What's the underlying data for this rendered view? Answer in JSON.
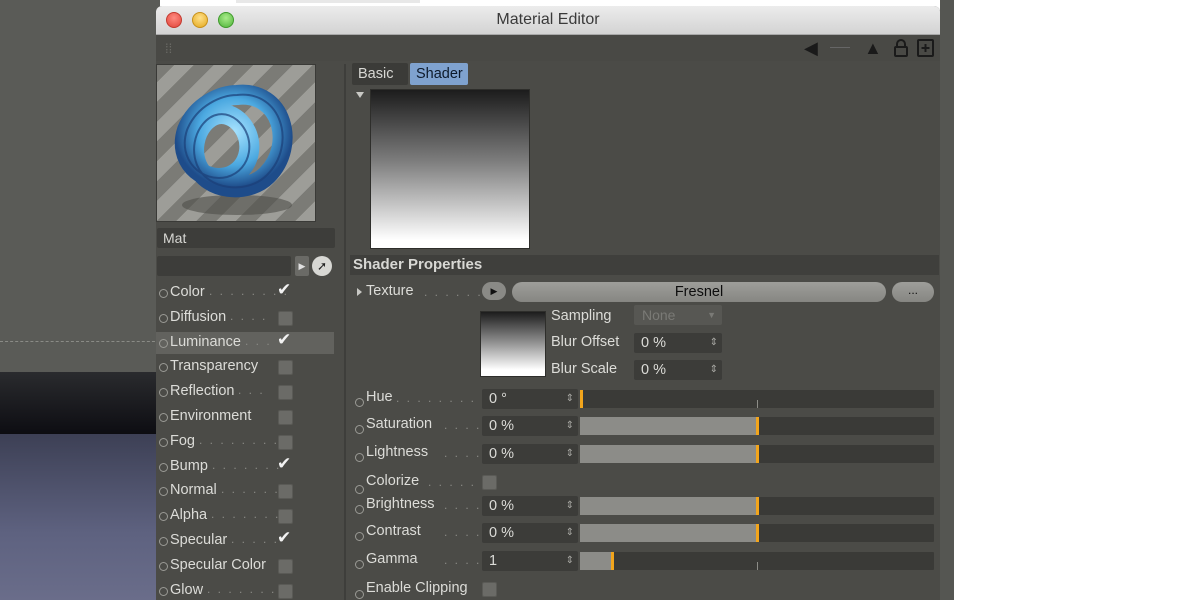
{
  "window": {
    "title": "Material Editor"
  },
  "material_name": "Mat",
  "channels": [
    {
      "label": "Color",
      "dots": ". . . . . . . .",
      "checked": true,
      "active": false
    },
    {
      "label": "Diffusion",
      "dots": ". . . .",
      "checked": false,
      "active": false
    },
    {
      "label": "Luminance",
      "dots": ". . .",
      "checked": true,
      "active": true
    },
    {
      "label": "Transparency",
      "dots": "",
      "checked": false,
      "active": false
    },
    {
      "label": "Reflection",
      "dots": ". . .",
      "checked": false,
      "active": false
    },
    {
      "label": "Environment",
      "dots": "",
      "checked": false,
      "active": false
    },
    {
      "label": "Fog",
      "dots": ". . . . . . . . .",
      "checked": false,
      "active": false
    },
    {
      "label": "Bump",
      "dots": ". . . . . . .",
      "checked": true,
      "active": false
    },
    {
      "label": "Normal",
      "dots": ". . . . . .",
      "checked": false,
      "active": false
    },
    {
      "label": "Alpha",
      "dots": ". . . . . . .",
      "checked": false,
      "active": false
    },
    {
      "label": "Specular",
      "dots": ". . . . .",
      "checked": true,
      "active": false
    },
    {
      "label": "Specular Color",
      "dots": "",
      "checked": false,
      "active": false
    },
    {
      "label": "Glow",
      "dots": ". . . . . . . .",
      "checked": false,
      "active": false
    }
  ],
  "tabs": {
    "basic": "Basic",
    "shader": "Shader"
  },
  "section": {
    "title": "Shader Properties"
  },
  "texture": {
    "label": "Texture",
    "dots": ". . . . . . .",
    "shader_name": "Fresnel",
    "more": "..."
  },
  "sampling": {
    "label": "Sampling",
    "value": "None"
  },
  "blur_offset": {
    "label": "Blur Offset",
    "value": "0 %"
  },
  "blur_scale": {
    "label": "Blur Scale",
    "value": "0 %"
  },
  "params": [
    {
      "key": "hue",
      "label": "Hue",
      "dots": ". . . . . . . . . .",
      "value": "0 °",
      "fraction": 0.0
    },
    {
      "key": "saturation",
      "label": "Saturation",
      "dots": ". . . .",
      "value": "0 %",
      "fraction": 0.5
    },
    {
      "key": "lightness",
      "label": "Lightness",
      "dots": ". . . . .",
      "value": "0 %",
      "fraction": 0.5
    },
    {
      "key": "brightness",
      "label": "Brightness",
      "dots": ". . . .",
      "value": "0 %",
      "fraction": 0.5
    },
    {
      "key": "contrast",
      "label": "Contrast",
      "dots": ". . . . .",
      "value": "0 %",
      "fraction": 0.5
    },
    {
      "key": "gamma",
      "label": "Gamma",
      "dots": ". . . . . . .",
      "value": "1",
      "fraction": 0.09
    }
  ],
  "colorize": {
    "label": "Colorize",
    "dots": ". . . . . ."
  },
  "enable_clipping": {
    "label": "Enable Clipping"
  },
  "colors": {
    "accent": "#f2a51c",
    "tab_selected": "#7fa2cf",
    "panel": "#4b4b47"
  }
}
